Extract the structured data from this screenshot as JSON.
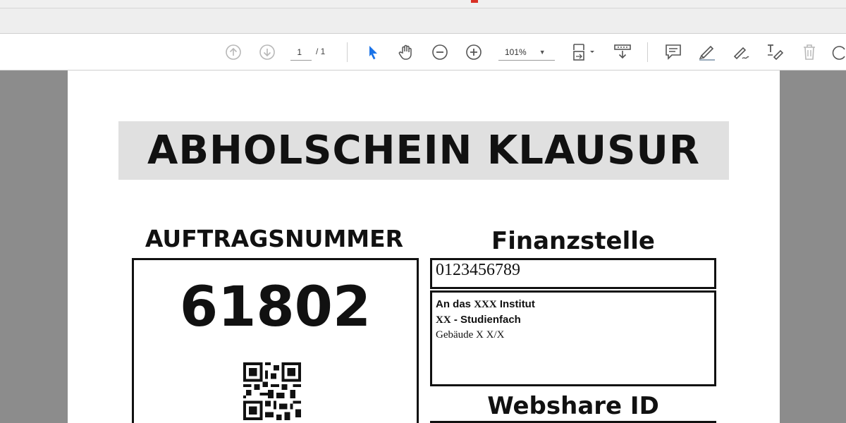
{
  "toolbar": {
    "page_current": "1",
    "page_total": "/ 1",
    "zoom": "101%"
  },
  "document": {
    "title": "ABHOLSCHEIN KLAUSUR",
    "auftrag_label": "AUFTRAGSNUMMER",
    "order_number": "61802",
    "finanz_label": "Finanzstelle",
    "finanz_value": "0123456789",
    "address": {
      "line1_a": "An das ",
      "line1_b": "XXX",
      "line1_c": " Institut",
      "line2_a": "XX",
      "line2_b": " - Studienfach",
      "line3": "Gebäude X X/X"
    },
    "webshare_label": "Webshare ID"
  },
  "colors": {
    "accent_blue": "#1a73e8",
    "icon_gray": "#555555",
    "disabled_gray": "#b8b8b8"
  }
}
